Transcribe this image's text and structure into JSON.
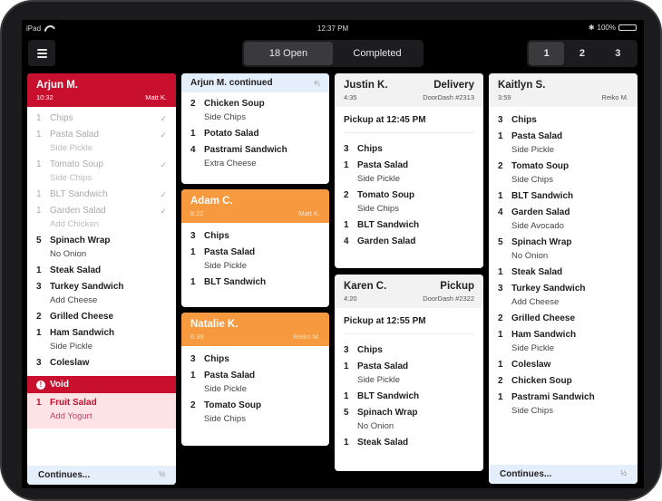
{
  "status_bar": {
    "device": "iPad",
    "time": "12:37 PM",
    "bluetooth": "✱",
    "battery": "100%",
    "battery_level": 1.0
  },
  "toolbar": {
    "menu_icon": "hamburger-icon",
    "status_tabs": [
      {
        "label": "18 Open",
        "active": true
      },
      {
        "label": "Completed",
        "active": false
      }
    ],
    "page_tabs": [
      {
        "label": "1",
        "active": true
      },
      {
        "label": "2",
        "active": false
      },
      {
        "label": "3",
        "active": false
      }
    ]
  },
  "colors": {
    "urgent_red": "#c8102e",
    "warning_orange": "#f6993f",
    "continued_blue": "#e5eefb",
    "void_pink": "#fde3e6"
  },
  "tickets": {
    "arjun": {
      "name": "Arjun M.",
      "elapsed": "10:32",
      "server": "Matt K.",
      "items": [
        {
          "qty": "1",
          "name": "Chips",
          "done": true,
          "check": "✓"
        },
        {
          "qty": "1",
          "name": "Pasta Salad",
          "mod": "Side Pickle",
          "done": true,
          "check": "✓"
        },
        {
          "qty": "1",
          "name": "Tomato Soup",
          "mod": "Side Chips",
          "done": true,
          "check": "✓"
        },
        {
          "qty": "1",
          "name": "BLT Sandwich",
          "done": true,
          "check": "✓"
        },
        {
          "qty": "1",
          "name": "Garden Salad",
          "mod": "Add Chicken",
          "done": true,
          "check": "✓"
        },
        {
          "qty": "5",
          "name": "Spinach Wrap",
          "mod": "No Onion"
        },
        {
          "qty": "1",
          "name": "Steak Salad"
        },
        {
          "qty": "3",
          "name": "Turkey Sandwich",
          "mod": "Add Cheese"
        },
        {
          "qty": "2",
          "name": "Grilled Cheese"
        },
        {
          "qty": "1",
          "name": "Ham Sandwich",
          "mod": "Side Pickle"
        },
        {
          "qty": "3",
          "name": "Coleslaw"
        }
      ],
      "void_label": "Void",
      "void_icon": "!",
      "void_items": [
        {
          "qty": "1",
          "name": "Fruit Salad",
          "mod": "Add Yogurt"
        }
      ],
      "continues_label": "Continues...",
      "page_fraction": "½"
    },
    "arjun_cont": {
      "name": "Arjun M. continued",
      "page_fraction": "²⁄₂",
      "items": [
        {
          "qty": "2",
          "name": "Chicken Soup",
          "mod": "Side Chips"
        },
        {
          "qty": "1",
          "name": "Potato Salad"
        },
        {
          "qty": "4",
          "name": "Pastrami Sandwich",
          "mod": "Extra Cheese"
        }
      ]
    },
    "adam": {
      "name": "Adam C.",
      "elapsed": "8:22",
      "server": "Matt K.",
      "items": [
        {
          "qty": "3",
          "name": "Chips"
        },
        {
          "qty": "1",
          "name": "Pasta Salad",
          "mod": "Side Pickle"
        },
        {
          "qty": "1",
          "name": "BLT Sandwich"
        }
      ]
    },
    "natalie": {
      "name": "Natalie K.",
      "elapsed": "6:38",
      "server": "Reiko M.",
      "items": [
        {
          "qty": "3",
          "name": "Chips"
        },
        {
          "qty": "1",
          "name": "Pasta Salad",
          "mod": "Side Pickle"
        },
        {
          "qty": "2",
          "name": "Tomato Soup",
          "mod": "Side Chips"
        }
      ]
    },
    "justin": {
      "name": "Justin K.",
      "type": "Delivery",
      "elapsed": "4:35",
      "source": "DoorDash #2313",
      "pickup": "Pickup at 12:45 PM",
      "items": [
        {
          "qty": "3",
          "name": "Chips"
        },
        {
          "qty": "1",
          "name": "Pasta Salad",
          "mod": "Side Pickle"
        },
        {
          "qty": "2",
          "name": "Tomato Soup",
          "mod": "Side Chips"
        },
        {
          "qty": "1",
          "name": "BLT Sandwich"
        },
        {
          "qty": "4",
          "name": "Garden Salad"
        }
      ]
    },
    "karen": {
      "name": "Karen C.",
      "type": "Pickup",
      "elapsed": "4:20",
      "source": "DoorDash #2322",
      "pickup": "Pickup at 12:55 PM",
      "items": [
        {
          "qty": "3",
          "name": "Chips"
        },
        {
          "qty": "1",
          "name": "Pasta Salad",
          "mod": "Side Pickle"
        },
        {
          "qty": "1",
          "name": "BLT Sandwich"
        },
        {
          "qty": "5",
          "name": "Spinach Wrap",
          "mod": "No Onion"
        },
        {
          "qty": "1",
          "name": "Steak Salad"
        }
      ]
    },
    "kaitlyn": {
      "name": "Kaitlyn S.",
      "elapsed": "3:59",
      "server": "Reiko M.",
      "items": [
        {
          "qty": "3",
          "name": "Chips"
        },
        {
          "qty": "1",
          "name": "Pasta Salad",
          "mod": "Side Pickle"
        },
        {
          "qty": "2",
          "name": "Tomato Soup",
          "mod": "Side Chips"
        },
        {
          "qty": "1",
          "name": "BLT Sandwich"
        },
        {
          "qty": "4",
          "name": "Garden Salad",
          "mod": "Side Avocado"
        },
        {
          "qty": "5",
          "name": "Spinach Wrap",
          "mod": "No Onion"
        },
        {
          "qty": "1",
          "name": "Steak Salad"
        },
        {
          "qty": "3",
          "name": "Turkey Sandwich",
          "mod": "Add Cheese"
        },
        {
          "qty": "2",
          "name": "Grilled Cheese"
        },
        {
          "qty": "1",
          "name": "Ham Sandwich",
          "mod": "Side Pickle"
        },
        {
          "qty": "1",
          "name": "Coleslaw"
        },
        {
          "qty": "2",
          "name": "Chicken Soup"
        },
        {
          "qty": "1",
          "name": "Pastrami Sandwich",
          "mod": "Side Chips"
        }
      ],
      "continues_label": "Continues...",
      "page_fraction": "½"
    }
  }
}
